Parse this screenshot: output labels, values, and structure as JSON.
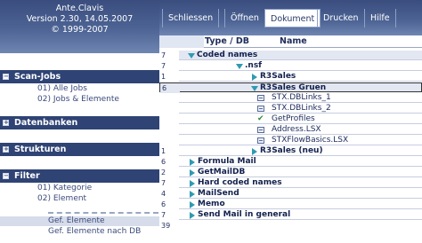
{
  "brand": {
    "line1": "Ante.Clavis",
    "line2": "Version 2.30, 14.05.2007",
    "line3": "© 1999-2007"
  },
  "sidebar": {
    "sections": [
      {
        "toggle": "−",
        "label": "Scan-Jobs"
      },
      {
        "toggle": "+",
        "label": "Datenbanken"
      },
      {
        "toggle": "+",
        "label": "Strukturen"
      },
      {
        "toggle": "−",
        "label": "Filter"
      }
    ],
    "scan_jobs": [
      "01) Alle Jobs",
      "02) Jobs & Elemente"
    ],
    "filter": [
      "01) Kategorie",
      "02) Element"
    ],
    "plain": [
      "Gef. Elemente",
      "Gef. Elemente nach DB"
    ]
  },
  "toolbar": {
    "buttons": [
      "Schliessen",
      "Öffnen",
      "Dokument",
      "Drucken",
      "Hilfe"
    ]
  },
  "grid": {
    "headers": [
      "Type / DB",
      "Name"
    ],
    "rows": [
      {
        "num": "7",
        "name": "Coded names"
      },
      {
        "num": "7",
        "name": ".nsf"
      },
      {
        "num": "1",
        "name": "R3Sales"
      },
      {
        "num": "6",
        "name": "R3Sales Gruen"
      },
      {
        "num": "",
        "name": "STX.DBLinks_1"
      },
      {
        "num": "",
        "name": "STX.DBLinks_2"
      },
      {
        "num": "",
        "name": "GetProfiles"
      },
      {
        "num": "",
        "name": "Address.LSX"
      },
      {
        "num": "",
        "name": "STXFlowBasics.LSX"
      },
      {
        "num": "1",
        "name": "R3Sales (neu)"
      },
      {
        "num": "6",
        "name": "Formula Mail"
      },
      {
        "num": "2",
        "name": "GetMailDB"
      },
      {
        "num": "7",
        "name": "Hard coded names"
      },
      {
        "num": "4",
        "name": "MailSend"
      },
      {
        "num": "6",
        "name": "Memo"
      },
      {
        "num": "7",
        "name": "Send Mail in general"
      },
      {
        "num": "39",
        "name": ""
      }
    ]
  },
  "colors": {
    "header_navy": "#2f4374",
    "gradient_top": "#3a4d7e",
    "gradient_bottom": "#6f86b3",
    "tree_arrow": "#2f9ab0"
  },
  "icons": {
    "expanded": "triangle-down-icon",
    "collapsed": "triangle-right-icon",
    "document": "document-icon",
    "agent": "checkmark-icon"
  }
}
